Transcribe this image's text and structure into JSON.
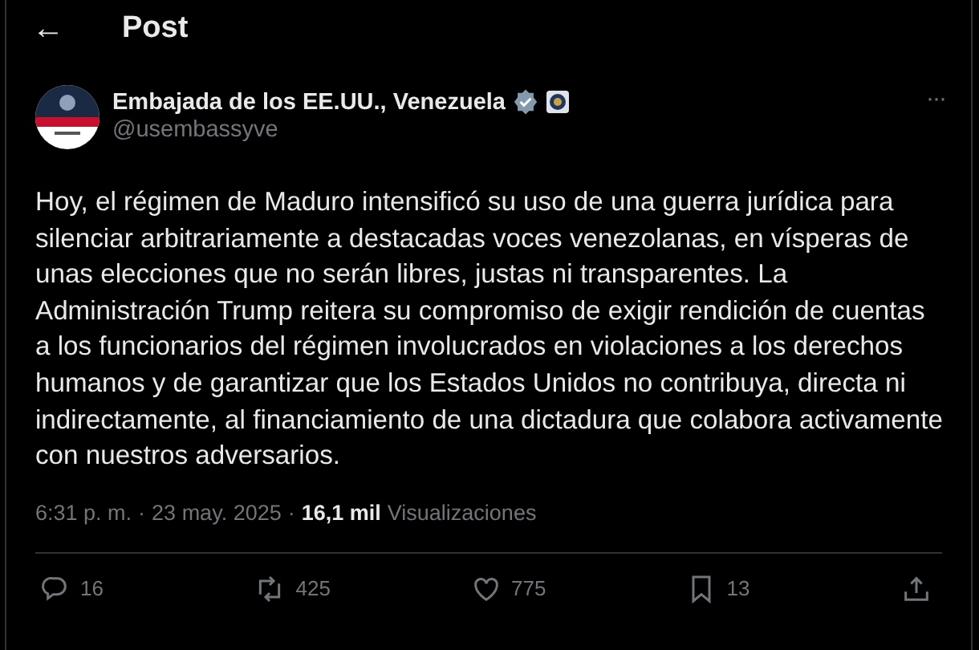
{
  "header": {
    "back": "←",
    "title": "Post"
  },
  "author": {
    "name": "Embajada de los EE.UU., Venezuela",
    "handle": "@usembassyve",
    "verified": true,
    "more": "···"
  },
  "body": "Hoy, el régimen de Maduro intensificó su uso de una guerra jurídica para silenciar arbitrariamente a destacadas voces venezolanas, en vísperas de unas elecciones que no serán libres, justas ni transparentes. La Administración Trump reitera su compromiso de exigir rendición de cuentas a los funcionarios del régimen involucrados en violaciones a los derechos humanos y de garantizar que los Estados Unidos no contribuya, directa ni indirectamente, al financiamiento de una dictadura que colabora activamente con nuestros adversarios.",
  "meta": {
    "time": "6:31 p. m.",
    "sep": "·",
    "date": "23 may. 2025",
    "views": "16,1 mil",
    "views_label": "Visualizaciones"
  },
  "actions": [
    {
      "kind": "reply",
      "count": "16"
    },
    {
      "kind": "repost",
      "count": "425"
    },
    {
      "kind": "like",
      "count": "775"
    },
    {
      "kind": "bookmark",
      "count": "13"
    },
    {
      "kind": "share"
    }
  ]
}
